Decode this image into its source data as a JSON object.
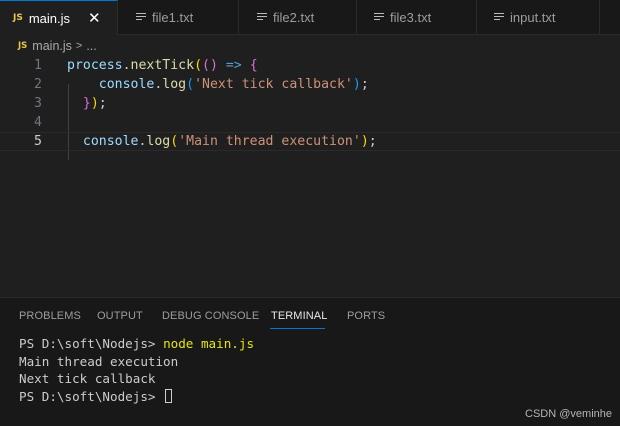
{
  "tabs": [
    {
      "label": "main.js",
      "badge": "JS",
      "active": true
    },
    {
      "label": "file1.txt"
    },
    {
      "label": "file2.txt"
    },
    {
      "label": "file3.txt"
    },
    {
      "label": "input.txt"
    }
  ],
  "close_glyph": "✕",
  "breadcrumb": {
    "badge": "JS",
    "file": "main.js",
    "separator": ">",
    "trail": "..."
  },
  "editor": {
    "line_numbers": [
      "1",
      "2",
      "3",
      "4",
      "5"
    ],
    "current_line": "5",
    "lines": [
      {
        "tokens": [
          {
            "t": "process",
            "c": "t-var"
          },
          {
            "t": ".",
            "c": "t-plain"
          },
          {
            "t": "nextTick",
            "c": "t-fn"
          },
          {
            "t": "(",
            "c": "t-paren1"
          },
          {
            "t": "()",
            "c": "t-paren2"
          },
          {
            "t": " ",
            "c": "t-plain"
          },
          {
            "t": "=>",
            "c": "t-kw"
          },
          {
            "t": " ",
            "c": "t-plain"
          },
          {
            "t": "{",
            "c": "t-paren2"
          }
        ]
      },
      {
        "tokens": [
          {
            "t": "    ",
            "c": "t-plain"
          },
          {
            "t": "console",
            "c": "t-var"
          },
          {
            "t": ".",
            "c": "t-plain"
          },
          {
            "t": "log",
            "c": "t-fn"
          },
          {
            "t": "(",
            "c": "t-paren3"
          },
          {
            "t": "'Next tick callback'",
            "c": "t-str"
          },
          {
            "t": ")",
            "c": "t-paren3"
          },
          {
            "t": ";",
            "c": "t-plain"
          }
        ]
      },
      {
        "tokens": [
          {
            "t": "  ",
            "c": "t-plain"
          },
          {
            "t": "}",
            "c": "t-paren2"
          },
          {
            "t": ")",
            "c": "t-paren1"
          },
          {
            "t": ";",
            "c": "t-plain"
          }
        ]
      },
      {
        "tokens": []
      },
      {
        "tokens": [
          {
            "t": "  ",
            "c": "t-plain"
          },
          {
            "t": "console",
            "c": "t-var"
          },
          {
            "t": ".",
            "c": "t-plain"
          },
          {
            "t": "log",
            "c": "t-fn"
          },
          {
            "t": "(",
            "c": "t-paren1"
          },
          {
            "t": "'Main thread execution'",
            "c": "t-str"
          },
          {
            "t": ")",
            "c": "t-paren1"
          },
          {
            "t": ";",
            "c": "t-plain"
          }
        ]
      }
    ]
  },
  "panel": {
    "tabs": [
      {
        "label": "PROBLEMS"
      },
      {
        "label": "OUTPUT"
      },
      {
        "label": "DEBUG CONSOLE"
      },
      {
        "label": "TERMINAL",
        "active": true
      },
      {
        "label": "PORTS"
      }
    ],
    "terminal": {
      "prompt1": "PS D:\\soft\\Nodejs> ",
      "command": "node main.js",
      "output1": "Main thread execution",
      "output2": "Next tick callback",
      "prompt2": "PS D:\\soft\\Nodejs> "
    }
  },
  "watermark": "CSDN @veminhe",
  "colors": {
    "accent": "#0078d4",
    "js_badge": "#e8c84a",
    "string": "#ce9178",
    "function": "#dcdcaa",
    "variable": "#9cdcfe"
  }
}
